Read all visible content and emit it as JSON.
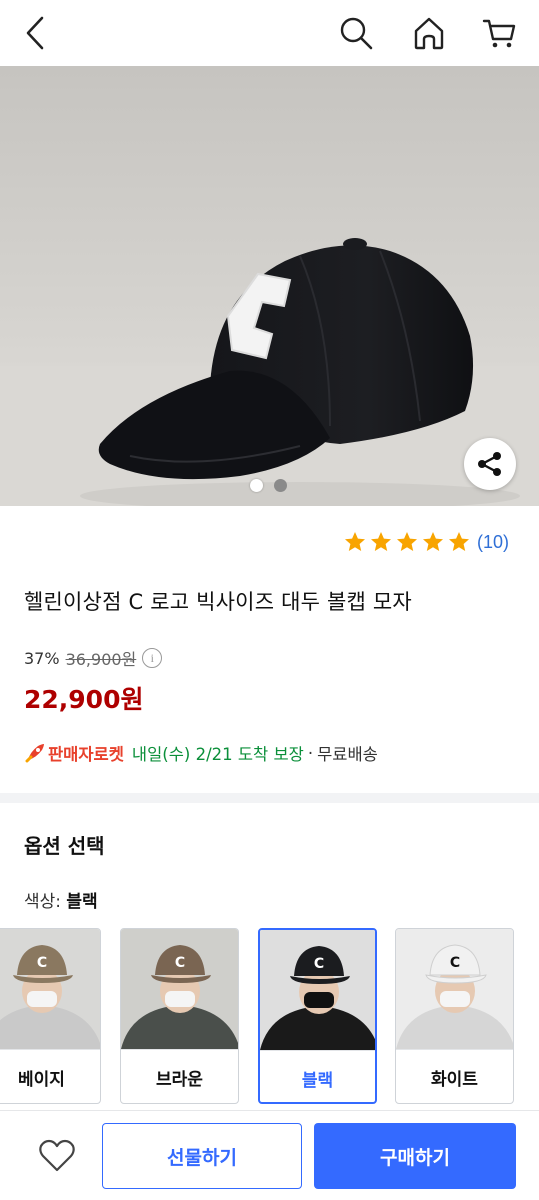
{
  "nav": {
    "back_icon": "chevron-left-icon",
    "search_icon": "search-icon",
    "home_icon": "home-icon",
    "cart_icon": "cart-icon"
  },
  "hero": {
    "image_index": 1,
    "image_count": 2
  },
  "product": {
    "rating_stars": 5,
    "review_count": "(10)",
    "title": "헬린이상점 C 로고 빅사이즈 대두 볼캡 모자",
    "discount": "37%",
    "original_price": "36,900원",
    "info_symbol": "i",
    "sale_price": "22,900원"
  },
  "delivery": {
    "badge": "판매자로켓",
    "date": "내일(수) 2/21 도착 보장",
    "separator": "·",
    "shipping": "무료배송"
  },
  "options": {
    "heading": "옵션 선택",
    "color_label": "색상:",
    "color_value": "블랙",
    "items": [
      {
        "label": "베이지",
        "selected": false,
        "cap_color": "#8a7860"
      },
      {
        "label": "브라운",
        "selected": false,
        "cap_color": "#7a6552"
      },
      {
        "label": "블랙",
        "selected": true,
        "cap_color": "#1b1c1f"
      },
      {
        "label": "화이트",
        "selected": false,
        "cap_color": "#f1f1f1"
      }
    ]
  },
  "bottom": {
    "gift_label": "선물하기",
    "buy_label": "구매하기"
  },
  "colors": {
    "accent": "#346aff",
    "price_red": "#ae0000",
    "rocket_red": "#e8412c",
    "delivery_green": "#0b8f3a",
    "star": "#f8a400"
  }
}
